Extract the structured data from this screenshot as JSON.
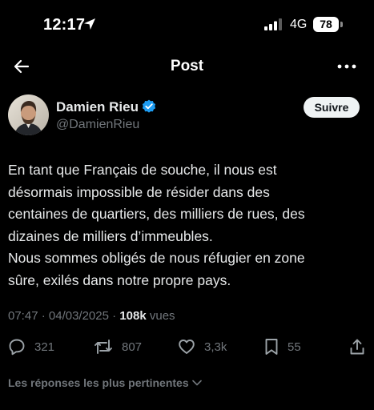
{
  "status_bar": {
    "time": "12:17",
    "network": "4G",
    "battery": "78"
  },
  "header": {
    "title": "Post"
  },
  "author": {
    "name": "Damien Rieu",
    "handle": "@DamienRieu",
    "follow_label": "Suivre"
  },
  "tweet": {
    "lines": [
      "En tant que Français de souche, il nous est",
      "désormais impossible de résider dans des",
      "centaines de quartiers, des milliers de rues, des",
      "dizaines de milliers d’immeubles.",
      "Nous sommes obligés de nous réfugier en zone",
      "sûre, exilés dans notre propre pays."
    ]
  },
  "meta": {
    "time": "07:47",
    "separator": " · ",
    "date": "04/03/2025",
    "views": "108k",
    "views_label": " vues"
  },
  "actions": {
    "replies": "321",
    "reposts": "807",
    "likes": "3,3k",
    "bookmarks": "55"
  },
  "replies_sort_label": "Les réponses les plus pertinentes",
  "colors": {
    "background": "#000000",
    "text": "#e7e9ea",
    "muted": "#71767b",
    "verified": "#1d9bf0",
    "follow_bg": "#eff3f4"
  },
  "icons": [
    "location-arrow-icon",
    "signal-icon",
    "battery-icon",
    "back-arrow-icon",
    "more-icon",
    "verified-badge-icon",
    "reply-icon",
    "repost-icon",
    "like-icon",
    "bookmark-icon",
    "share-icon",
    "chevron-down-icon"
  ]
}
